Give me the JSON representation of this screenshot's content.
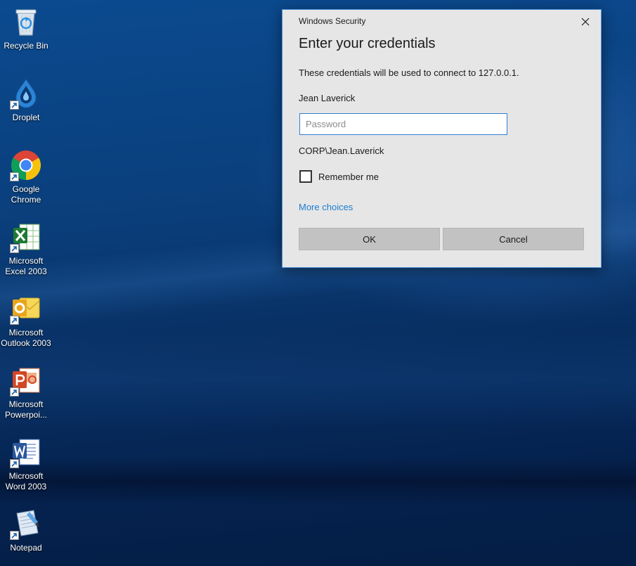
{
  "desktop": {
    "icons": [
      {
        "label": "Recycle Bin",
        "icon": "recycle-bin-icon"
      },
      {
        "label": "Droplet",
        "icon": "droplet-icon"
      },
      {
        "label": "Google\nChrome",
        "icon": "chrome-icon"
      },
      {
        "label": "Microsoft\nExcel 2003",
        "icon": "excel-icon"
      },
      {
        "label": "Microsoft\nOutlook 2003",
        "icon": "outlook-icon"
      },
      {
        "label": "Microsoft\nPowerpoi...",
        "icon": "powerpoint-icon"
      },
      {
        "label": "Microsoft\nWord 2003",
        "icon": "word-icon"
      },
      {
        "label": "Notepad",
        "icon": "notepad-icon"
      }
    ]
  },
  "dialog": {
    "window_title": "Windows Security",
    "heading": "Enter your credentials",
    "description": "These credentials will be used to connect to 127.0.0.1.",
    "username": "Jean Laverick",
    "password": {
      "value": "",
      "placeholder": "Password"
    },
    "domain_user": "CORP\\Jean.Laverick",
    "remember_label": "Remember me",
    "remember_checked": false,
    "more_choices": "More choices",
    "ok_label": "OK",
    "cancel_label": "Cancel"
  },
  "colors": {
    "link": "#1c7cd1",
    "input_border": "#2f7fd3",
    "dialog_bg": "#e6e6e6",
    "button_bg": "#c2c2c2"
  }
}
